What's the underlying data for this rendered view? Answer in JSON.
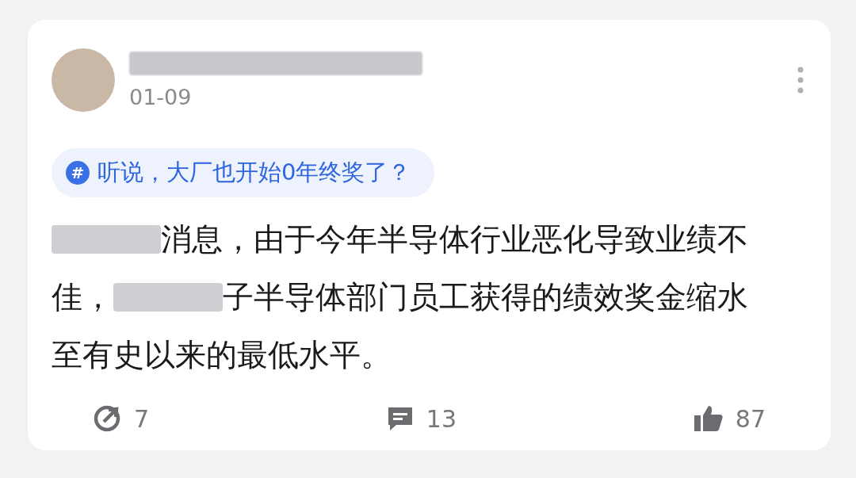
{
  "post": {
    "date": "01-09",
    "topic": {
      "icon": "#",
      "label": "听说，大厂也开始0年终奖了？"
    },
    "body": [
      [
        {
          "kind": "redacted"
        },
        {
          "kind": "text",
          "text": "消息，由于今年半导体行业恶化导致业绩不"
        }
      ],
      [
        {
          "kind": "text",
          "text": "佳，"
        },
        {
          "kind": "redacted"
        },
        {
          "kind": "text",
          "text": "子半导体部门员工获得的绩效奖金缩水"
        }
      ],
      [
        {
          "kind": "text",
          "text": "至有史以来的最低水平。"
        }
      ]
    ],
    "actions": [
      {
        "kind": "share",
        "count": "7"
      },
      {
        "kind": "comment",
        "count": "13"
      },
      {
        "kind": "like",
        "count": "87"
      }
    ]
  }
}
